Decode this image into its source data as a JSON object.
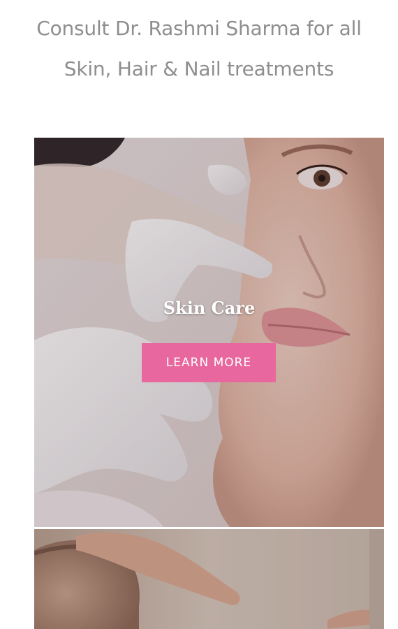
{
  "intro": {
    "line1": "Consult Dr. Rashmi Sharma for all",
    "line2": "Skin, Hair & Nail treatments"
  },
  "cards": [
    {
      "title": "Skin Care",
      "button_label": "LEARN MORE",
      "image": "woman-face-skin-treatment"
    },
    {
      "image": "hair-scalp-treatment"
    }
  ],
  "colors": {
    "intro_text": "#8e8e8e",
    "button_bg": "#e8679f",
    "button_text": "#ffffff",
    "card_title": "#ffffff"
  }
}
